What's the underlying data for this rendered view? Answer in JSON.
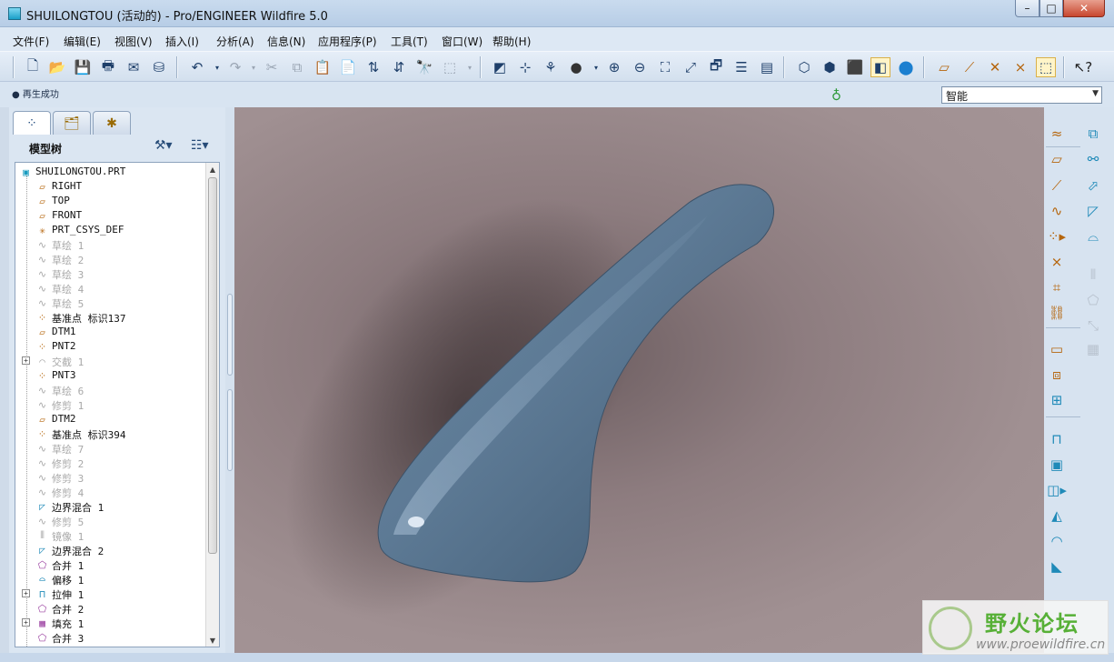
{
  "window": {
    "title": "SHUILONGTOU (活动的) - Pro/ENGINEER Wildfire 5.0",
    "min": "–",
    "max": "□",
    "close": "✕"
  },
  "menu": [
    "文件(F)",
    "编辑(E)",
    "视图(V)",
    "插入(I)",
    "分析(A)",
    "信息(N)",
    "应用程序(P)",
    "工具(T)",
    "窗口(W)",
    "帮助(H)"
  ],
  "status": {
    "message": "● 再生成功",
    "filter_value": "智能"
  },
  "panel": {
    "title": "模型树"
  },
  "tree": [
    {
      "label": "SHUILONGTOU.PRT",
      "icon": "part-icon",
      "grey": false,
      "expandable": false
    },
    {
      "label": "RIGHT",
      "icon": "datum-plane-icon",
      "grey": false,
      "expandable": false
    },
    {
      "label": "TOP",
      "icon": "datum-plane-icon",
      "grey": false,
      "expandable": false
    },
    {
      "label": "FRONT",
      "icon": "datum-plane-icon",
      "grey": false,
      "expandable": false
    },
    {
      "label": "PRT_CSYS_DEF",
      "icon": "csys-icon",
      "grey": false,
      "expandable": false
    },
    {
      "label": "草绘 1",
      "icon": "sketch-icon",
      "grey": true,
      "expandable": false
    },
    {
      "label": "草绘 2",
      "icon": "sketch-icon",
      "grey": true,
      "expandable": false
    },
    {
      "label": "草绘 3",
      "icon": "sketch-icon",
      "grey": true,
      "expandable": false
    },
    {
      "label": "草绘 4",
      "icon": "sketch-icon",
      "grey": true,
      "expandable": false
    },
    {
      "label": "草绘 5",
      "icon": "sketch-icon",
      "grey": true,
      "expandable": false
    },
    {
      "label": "基准点 标识137",
      "icon": "datum-point-icon",
      "grey": false,
      "expandable": false
    },
    {
      "label": "DTM1",
      "icon": "datum-plane-icon",
      "grey": false,
      "expandable": false
    },
    {
      "label": "PNT2",
      "icon": "datum-point-icon",
      "grey": false,
      "expandable": false
    },
    {
      "label": "交截 1",
      "icon": "intersect-icon",
      "grey": true,
      "expandable": true
    },
    {
      "label": "PNT3",
      "icon": "datum-point-icon",
      "grey": false,
      "expandable": false
    },
    {
      "label": "草绘 6",
      "icon": "sketch-icon",
      "grey": true,
      "expandable": false
    },
    {
      "label": "修剪 1",
      "icon": "trim-icon",
      "grey": true,
      "expandable": false
    },
    {
      "label": "DTM2",
      "icon": "datum-plane-icon",
      "grey": false,
      "expandable": false
    },
    {
      "label": "基准点 标识394",
      "icon": "datum-point-icon",
      "grey": false,
      "expandable": false
    },
    {
      "label": "草绘 7",
      "icon": "sketch-icon",
      "grey": true,
      "expandable": false
    },
    {
      "label": "修剪 2",
      "icon": "trim-icon",
      "grey": true,
      "expandable": false
    },
    {
      "label": "修剪 3",
      "icon": "trim-icon",
      "grey": true,
      "expandable": false
    },
    {
      "label": "修剪 4",
      "icon": "trim-icon",
      "grey": true,
      "expandable": false
    },
    {
      "label": "边界混合 1",
      "icon": "boundary-blend-icon",
      "grey": false,
      "expandable": false
    },
    {
      "label": "修剪 5",
      "icon": "trim-icon",
      "grey": true,
      "expandable": false
    },
    {
      "label": "镜像 1",
      "icon": "mirror-icon",
      "grey": true,
      "expandable": false
    },
    {
      "label": "边界混合 2",
      "icon": "boundary-blend-icon",
      "grey": false,
      "expandable": false
    },
    {
      "label": "合并 1",
      "icon": "merge-icon",
      "grey": false,
      "expandable": false
    },
    {
      "label": "偏移 1",
      "icon": "offset-icon",
      "grey": false,
      "expandable": false
    },
    {
      "label": "拉伸 1",
      "icon": "extrude-icon",
      "grey": false,
      "expandable": true
    },
    {
      "label": "合并 2",
      "icon": "merge-icon",
      "grey": false,
      "expandable": false
    },
    {
      "label": "填充 1",
      "icon": "fill-icon",
      "grey": false,
      "expandable": true
    },
    {
      "label": "合并 3",
      "icon": "merge-icon",
      "grey": false,
      "expandable": false
    }
  ],
  "watermark": {
    "text": "野火论坛",
    "url": "www.proewildfire.cn"
  },
  "colors": {
    "model": "#5f7d98",
    "background": "#a09092",
    "accent": "#b5650c"
  }
}
